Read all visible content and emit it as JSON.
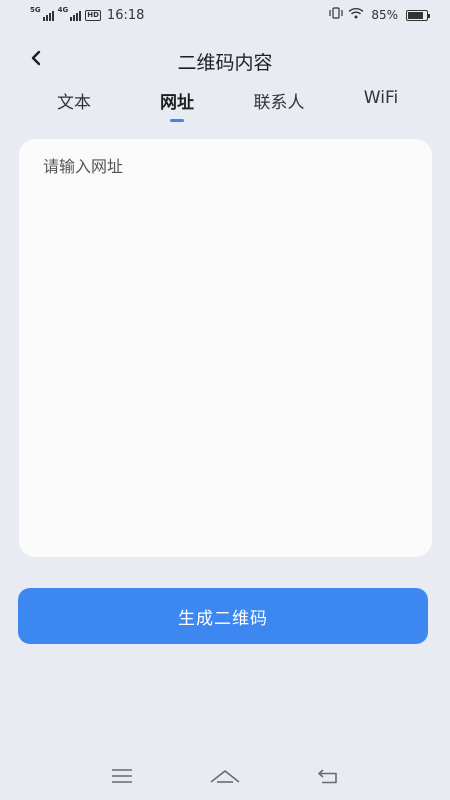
{
  "status_bar": {
    "signal1_label": "5G",
    "signal2_label": "4G",
    "hd_label": "HD",
    "time": "16:18",
    "battery_percent": "85%",
    "battery_level": 0.85
  },
  "header": {
    "title": "二维码内容"
  },
  "tabs": [
    {
      "label": "文本",
      "active": false
    },
    {
      "label": "网址",
      "active": true
    },
    {
      "label": "联系人",
      "active": false
    },
    {
      "label": "WiFi",
      "active": false
    }
  ],
  "input": {
    "value": "",
    "placeholder": "请输入网址"
  },
  "generate_button": {
    "label": "生成二维码"
  },
  "colors": {
    "accent": "#3d87f1",
    "background": "#e8ebf2",
    "card": "#fafafa"
  },
  "icons": {
    "back": "chevron-left-icon",
    "nav_menu": "menu-icon",
    "nav_home": "home-icon",
    "nav_back": "return-icon"
  }
}
